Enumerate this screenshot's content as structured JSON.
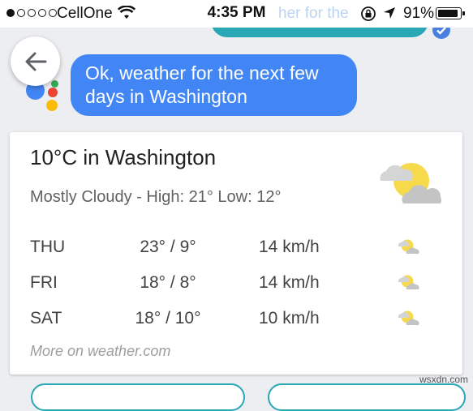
{
  "status_bar": {
    "carrier": "CellOne",
    "time": "4:35 PM",
    "battery": "91%",
    "battery_level": 0.91,
    "signal_bars_filled": 1,
    "signal_bars_total": 5,
    "faded_overlay_text": "her for the"
  },
  "conversation": {
    "assistant_message": "Ok, weather for the next few days in Washington"
  },
  "weather": {
    "title": "10°C in Washington",
    "summary": "Mostly Cloudy - High: 21° Low: 12°",
    "current_icon": "partly-cloudy-icon",
    "forecast": [
      {
        "day": "THU",
        "temp": "23° / 9°",
        "wind": "14 km/h",
        "icon": "partly-cloudy-icon"
      },
      {
        "day": "FRI",
        "temp": "18° / 8°",
        "wind": "14 km/h",
        "icon": "partly-cloudy-icon"
      },
      {
        "day": "SAT",
        "temp": "18° / 10°",
        "wind": "10 km/h",
        "icon": "partly-cloudy-icon"
      }
    ],
    "more_link": "More on weather.com"
  },
  "watermark": "wsxdn.com",
  "colors": {
    "assistant_bubble": "#4286f5",
    "user_bubble": "#2aa7b5",
    "background": "#eceef1",
    "sun": "#f7d94c",
    "cloud": "#c9c9c9"
  }
}
